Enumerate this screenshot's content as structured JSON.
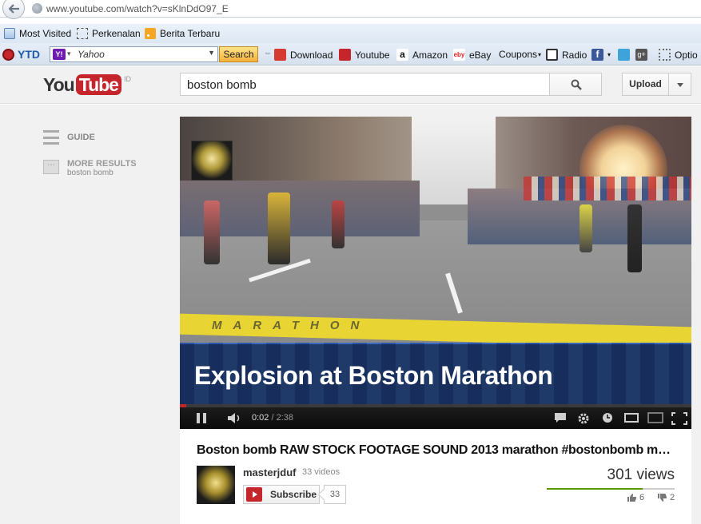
{
  "browser": {
    "url": "www.youtube.com/watch?v=sKlnDdO97_E",
    "bookmarks": [
      {
        "label": "Most Visited",
        "icon": "most-visited-icon"
      },
      {
        "label": "Perkenalan",
        "icon": "page-icon"
      },
      {
        "label": "Berita Terbaru",
        "icon": "rss-icon"
      }
    ],
    "toolbar": {
      "brand": "YTD",
      "search_placeholder": "Yahoo",
      "search_button": "Search",
      "items": [
        {
          "label": "Download",
          "icon": "download-icon"
        },
        {
          "label": "Youtube",
          "icon": "youtube-icon"
        },
        {
          "label": "Amazon",
          "icon": "amazon-icon"
        },
        {
          "label": "eBay",
          "icon": "ebay-icon"
        },
        {
          "label": "Coupons",
          "icon": "coupons-dropdown"
        },
        {
          "label": "Radio",
          "icon": "radio-icon"
        },
        {
          "label": "Optio",
          "icon": "options-icon"
        }
      ]
    }
  },
  "youtube": {
    "logo_you": "You",
    "logo_tube": "Tube",
    "logo_region": "ID",
    "search_query": "boston bomb",
    "upload_label": "Upload",
    "sidebar": {
      "guide_label": "GUIDE",
      "more_results_label": "MORE RESULTS",
      "more_results_sub": "boston bomb"
    },
    "player": {
      "caption": "Explosion at Boston Marathon",
      "finish_line_text": "MARATHON",
      "current_time": "0:02",
      "time_separator": " / ",
      "duration": "2:38",
      "progress_fraction": 0.013
    },
    "video": {
      "title": "Boston bomb RAW STOCK FOOTAGE SOUND 2013 marathon #bostonbomb mo…",
      "channel_name": "masterjduf",
      "video_count": "33 videos",
      "subscribe_label": "Subscribe",
      "subscriber_count": "33",
      "views": "301 views",
      "likes": "6",
      "dislikes": "2",
      "like_fraction": 0.75
    }
  },
  "colors": {
    "youtube_red": "#c4262b",
    "like_green": "#559900",
    "toolbar_blue": "#dde7f3"
  }
}
